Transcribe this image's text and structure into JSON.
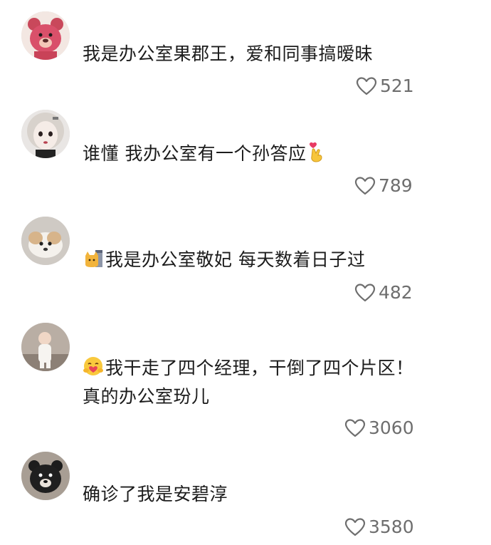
{
  "comments": [
    {
      "avatar_icon": "strawberry-bear-avatar",
      "text": "我是办公室果郡王，爱和同事搞暧昧",
      "text_line2": "",
      "emoji_icon": "",
      "trailing_emoji_icon": "",
      "likes": "521"
    },
    {
      "avatar_icon": "doll-girl-avatar",
      "text": "谁懂 我办公室有一个孙答应",
      "text_line2": "",
      "emoji_icon": "",
      "trailing_emoji_icon": "finger-heart-emoji",
      "likes": "789"
    },
    {
      "avatar_icon": "puppy-avatar",
      "text": "我是办公室敬妃  每天数着日子过",
      "text_line2": "",
      "emoji_icon": "cat-calendar-emoji",
      "trailing_emoji_icon": "",
      "likes": "482"
    },
    {
      "avatar_icon": "baby-avatar",
      "text": "我干走了四个经理，干倒了四个片区！",
      "text_line2": "真的办公室玢儿",
      "emoji_icon": "hug-emoji",
      "trailing_emoji_icon": "",
      "likes": "3060"
    },
    {
      "avatar_icon": "black-bear-avatar",
      "text": "确诊了我是安碧淳",
      "text_line2": "",
      "emoji_icon": "",
      "trailing_emoji_icon": "",
      "likes": "3580"
    }
  ],
  "colors": {
    "text": "#1c1c1c",
    "like": "#6e6e6e",
    "background": "#ffffff"
  }
}
